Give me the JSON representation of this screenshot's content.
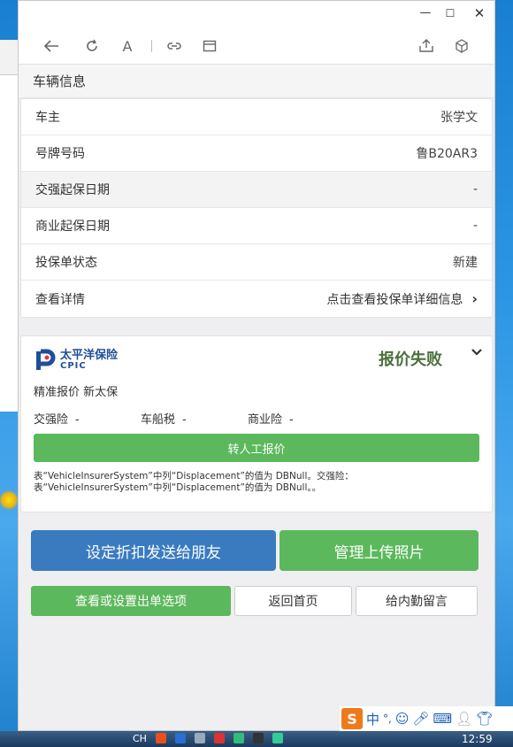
{
  "window": {
    "min_icon": "minimize-icon",
    "max_icon": "maximize-icon",
    "close_icon": "close-icon"
  },
  "toolbar": {
    "icons": [
      "back-arrow-icon",
      "refresh-icon",
      "font-size-icon",
      "link-icon",
      "window-icon",
      "share-icon",
      "cube-icon"
    ],
    "font_label": "A"
  },
  "vehicle_section": {
    "title": "车辆信息",
    "rows": [
      {
        "label": "车主",
        "value": "张学文"
      },
      {
        "label": "号牌号码",
        "value": "鲁B20AR3"
      },
      {
        "label": "交强起保日期",
        "value": "-"
      },
      {
        "label": "商业起保日期",
        "value": "-"
      },
      {
        "label": "投保单状态",
        "value": "新建"
      },
      {
        "label": "查看详情",
        "value": "点击查看投保单详细信息"
      }
    ]
  },
  "quote": {
    "insurer_name_cn": "太平洋保险",
    "insurer_name_en": "CPIC",
    "status": "报价失败",
    "subtitle": "精准报价 新太保",
    "fees": [
      {
        "label": "交强险",
        "value": "-"
      },
      {
        "label": "车船税",
        "value": "-"
      },
      {
        "label": "商业险",
        "value": "-"
      }
    ],
    "manual_button": "转人工报价",
    "error_line1": "表“VehicleInsurerSystem”中列“Displacement”的值为 DBNull。交强险：",
    "error_line2": "表“VehicleInsurerSystem”中列“Displacement”的值为 DBNull。。"
  },
  "actions": {
    "send_discount": "设定折扣发送给朋友",
    "upload_photos": "管理上传照片",
    "view_options": "查看或设置出单选项",
    "back_home": "返回首页",
    "leave_message": "给内勤留言"
  },
  "ime": {
    "logo": "S",
    "lang": "中",
    "punct": "°,",
    "icons": [
      "emoji-icon",
      "microphone-icon",
      "keyboard-icon",
      "user-icon",
      "shirt-icon"
    ]
  },
  "taskbar": {
    "lang": "CH",
    "time": "12:59"
  },
  "colors": {
    "green": "#5cb85c",
    "blue": "#3a7bbf",
    "status_text": "#4b6f3a"
  }
}
